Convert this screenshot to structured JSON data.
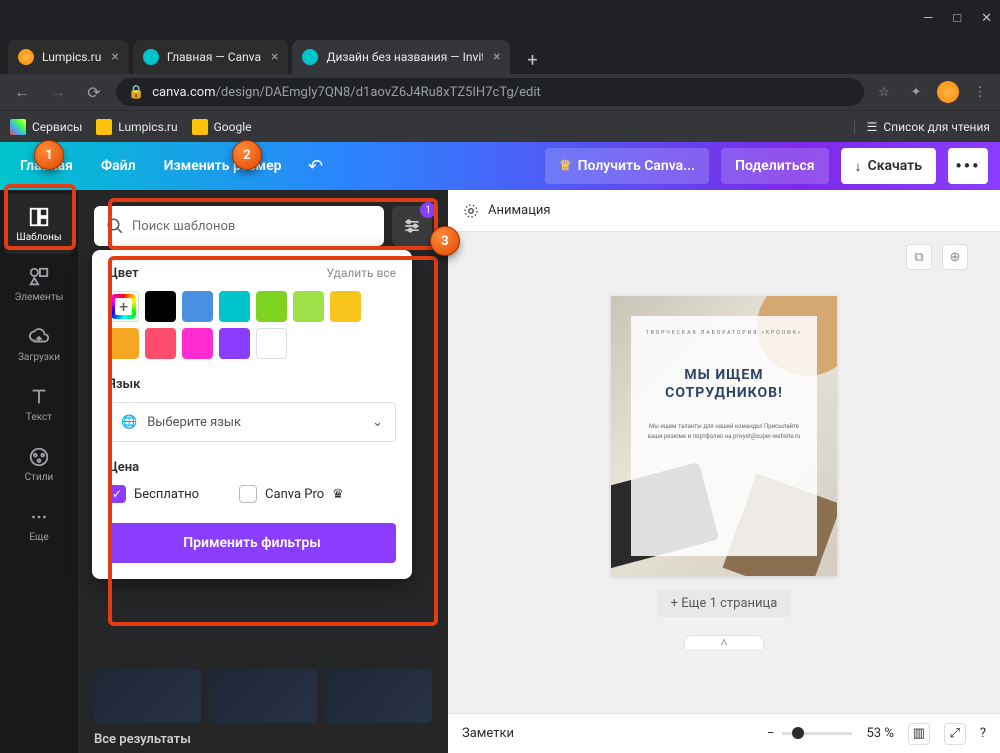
{
  "window": {
    "min": "—",
    "max": "□",
    "close": "✕"
  },
  "tabs": [
    {
      "title": "Lumpics.ru"
    },
    {
      "title": "Главная — Canva"
    },
    {
      "title": "Дизайн без названия — Invitat"
    }
  ],
  "newtab": "+",
  "nav": {
    "back": "←",
    "fwd": "→",
    "reload": "⟳"
  },
  "address": {
    "lock": "🔒",
    "domain": "canva.com",
    "path": "/design/DAEmgIy7QN8/d1aovZ6J4Ru8xTZ5IH7cTg/edit"
  },
  "addrbar_icons": {
    "star": "☆",
    "ext": "⋮"
  },
  "bookmarks": {
    "services": "Сервисы",
    "lumpics": "Lumpics.ru",
    "google": "Google",
    "readlist": "Список для чтения"
  },
  "canva_menu": {
    "home": "Главная",
    "file": "Файл",
    "resize": "Изменить размер",
    "undo": "↶",
    "pro": "Получить Canva...",
    "crown": "♕",
    "share": "Поделиться",
    "download": "Скачать",
    "dl_icon": "↓",
    "more": "•••"
  },
  "sidebar": {
    "templates": "Шаблоны",
    "elements": "Элементы",
    "uploads": "Загрузки",
    "text": "Текст",
    "styles": "Стили",
    "more": "Еще"
  },
  "panel": {
    "search_placeholder": "Поиск шаблонов",
    "filter_badge": "1",
    "color_title": "Цвет",
    "clear_all": "Удалить все",
    "colors": [
      "#000000",
      "#4a90e2",
      "#00c4cc",
      "#7ed321",
      "#9de04a",
      "#f8c51c",
      "#f5a623",
      "#ff4d6d",
      "#ff2dd1",
      "#8b3dff",
      "#ffffff"
    ],
    "lang_title": "Язык",
    "lang_placeholder": "Выберите язык",
    "price_title": "Цена",
    "free": "Бесплатно",
    "pro": "Canva Pro",
    "crown": "♛",
    "apply": "Применить фильтры",
    "all_results": "Все результаты"
  },
  "canvas": {
    "animation": "Анимация",
    "page_subtitle": "ТВОРЧЕСКАЯ ЛАБОРАТОРИЯ «КРОЛИК»",
    "page_title_1": "МЫ ИЩЕМ",
    "page_title_2": "СОТРУДНИКОВ!",
    "page_body": "Мы ищем таланты для нашей команды! Присылайте ваши резюме и портфолио на privyet@super-website.ru",
    "addpage": "+ Еще 1 страница",
    "collapse": "˄",
    "notes": "Заметки",
    "zoom": "53 %",
    "help": "?"
  },
  "markers": {
    "m1": "1",
    "m2": "2",
    "m3": "3"
  }
}
